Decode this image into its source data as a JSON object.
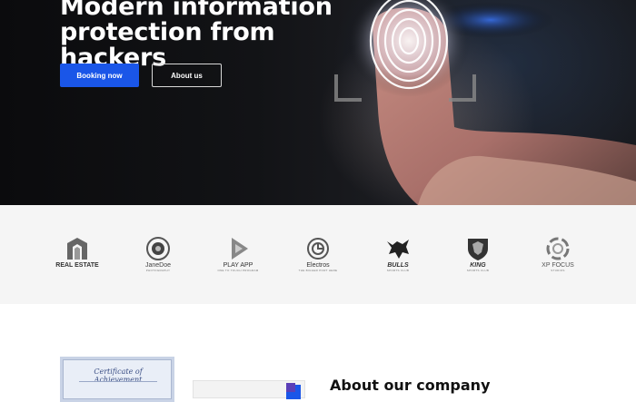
{
  "hero": {
    "title": "Modern information protection from hackers",
    "primary_button": "Booking now",
    "secondary_button": "About us"
  },
  "partners": [
    {
      "name": "REAL ESTATE",
      "sub": "",
      "icon": "building-icon"
    },
    {
      "name": "JaneDoe",
      "sub": "PHOTOGRAPHY",
      "icon": "camera-lens-icon"
    },
    {
      "name": "PLAY APP",
      "sub": "ONE TO TOUCH PROGRAM",
      "icon": "play-icon"
    },
    {
      "name": "Electros",
      "sub": "THE BIGGER PORT HERE",
      "icon": "electric-circle-icon"
    },
    {
      "name": "BULLS",
      "sub": "SPORTS CLUB",
      "icon": "bull-icon"
    },
    {
      "name": "KING",
      "sub": "SPORTS CLUB",
      "icon": "lion-shield-icon"
    },
    {
      "name": "XP FOCUS",
      "sub": "STUDIOS",
      "icon": "focus-ring-icon"
    }
  ],
  "about": {
    "title": "About our company",
    "certificate_text": "Certificate of Achievement"
  },
  "colors": {
    "accent": "#1a56e8",
    "hero_bg": "#121316",
    "strip_bg": "#f5f5f5"
  }
}
